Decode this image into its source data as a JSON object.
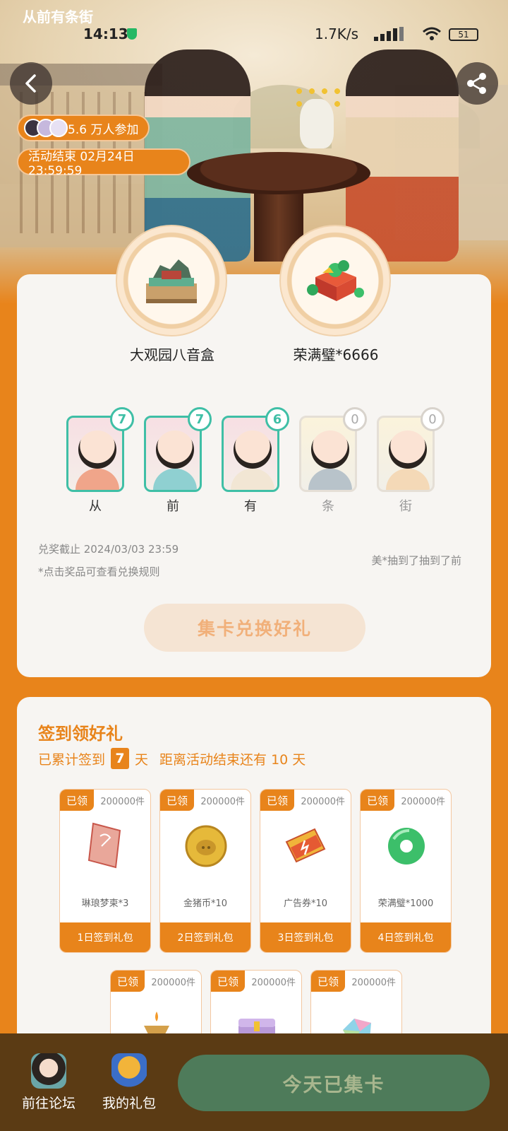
{
  "status_bar": {
    "brand": "从前有条街",
    "time": "14:13",
    "speed": "1.7K/s",
    "battery": "51"
  },
  "hero": {
    "participants": "5.6 万人参加",
    "activity_end": "活动结束 02月24日 23:59:59"
  },
  "prizes": [
    {
      "name": "大观园八音盒",
      "icon": "music-box-icon"
    },
    {
      "name": "荣满璧*6666",
      "icon": "jade-gift-icon"
    }
  ],
  "collect_cards": [
    {
      "label": "从",
      "count": "7",
      "collected": true
    },
    {
      "label": "前",
      "count": "7",
      "collected": true
    },
    {
      "label": "有",
      "count": "6",
      "collected": true
    },
    {
      "label": "条",
      "count": "0",
      "collected": false
    },
    {
      "label": "街",
      "count": "0",
      "collected": false
    }
  ],
  "redeem": {
    "deadline": "兑奖截止 2024/03/03 23:59",
    "note": "*点击奖品可查看兑换规则",
    "ticker": "美*抽到了抽到了前",
    "button": "集卡兑换好礼"
  },
  "signin": {
    "title": "签到领好礼",
    "prefix": "已累计签到",
    "days": "7",
    "day_unit": "天",
    "remaining": "距离活动结束还有 10 天",
    "rewards": [
      {
        "tag": "已领",
        "qty": "200000件",
        "name": "琳琅梦柬*3",
        "package": "1日签到礼包",
        "icon": "ticket-icon"
      },
      {
        "tag": "已领",
        "qty": "200000件",
        "name": "金猪币*10",
        "package": "2日签到礼包",
        "icon": "pig-coin-icon"
      },
      {
        "tag": "已领",
        "qty": "200000件",
        "name": "广告券*10",
        "package": "3日签到礼包",
        "icon": "ad-coupon-icon"
      },
      {
        "tag": "已领",
        "qty": "200000件",
        "name": "荣满璧*1000",
        "package": "4日签到礼包",
        "icon": "jade-disc-icon"
      },
      {
        "tag": "已领",
        "qty": "200000件",
        "icon": "lamp-icon"
      },
      {
        "tag": "已领",
        "qty": "200000件",
        "icon": "chest-icon"
      },
      {
        "tag": "已领",
        "qty": "200000件",
        "icon": "crystal-icon"
      }
    ]
  },
  "bottom_bar": {
    "forum": "前往论坛",
    "gift": "我的礼包",
    "collected": "今天已集卡"
  },
  "colors": {
    "accent": "#e8841b",
    "teal": "#3fbfa6",
    "bottom_bar": "#5b3b14",
    "collected_button": "#4e7b5a"
  }
}
